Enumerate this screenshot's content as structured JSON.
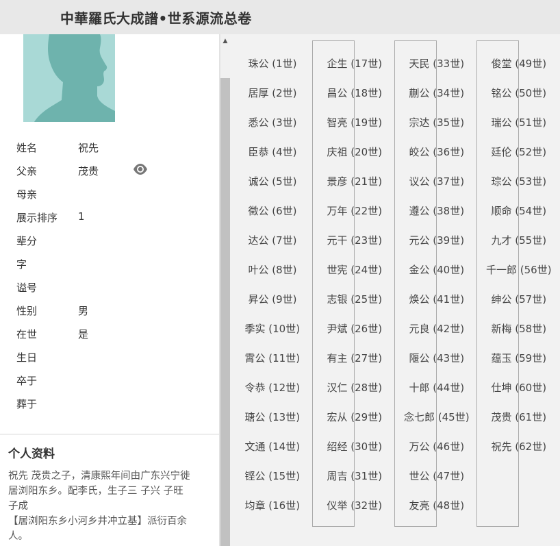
{
  "header": {
    "title": "中華羅氏大成譜•世系源流总卷"
  },
  "profile": {
    "fields": [
      {
        "label": "姓名",
        "value": "祝先"
      },
      {
        "label": "父亲",
        "value": "茂贵"
      },
      {
        "label": "母亲",
        "value": ""
      },
      {
        "label": "展示排序",
        "value": "1"
      },
      {
        "label": "辈分",
        "value": ""
      },
      {
        "label": "字",
        "value": ""
      },
      {
        "label": "谥号",
        "value": ""
      },
      {
        "label": "性别",
        "value": "男"
      },
      {
        "label": "在世",
        "value": "是"
      },
      {
        "label": "生日",
        "value": ""
      },
      {
        "label": "卒于",
        "value": ""
      },
      {
        "label": "葬于",
        "value": ""
      }
    ],
    "section_title": "个人资料",
    "bio_lines": [
      "祝先  茂贵之子，清康熙年间由广东兴宁徙",
      "居浏阳东乡。配李氏，生子三  子兴   子旺",
      "子成",
      "【居浏阳东乡小河乡井冲立基】派衍百余",
      "人。"
    ]
  },
  "scrollbar": {
    "up_arrow": "▲"
  },
  "lineage": {
    "columns": [
      [
        "珠公 (1世)",
        "居厚 (2世)",
        "悉公 (3世)",
        "臣恭 (4世)",
        "诚公 (5世)",
        "徵公 (6世)",
        "达公 (7世)",
        "叶公 (8世)",
        "昇公 (9世)",
        "季实 (10世)",
        "霄公 (11世)",
        "令恭 (12世)",
        "瑭公 (13世)",
        "文通 (14世)",
        "铿公 (15世)",
        "均章 (16世)"
      ],
      [
        "企生 (17世)",
        "昌公 (18世)",
        "智亮 (19世)",
        "庆祖 (20世)",
        "景彦 (21世)",
        "万年 (22世)",
        "元干 (23世)",
        "世宪 (24世)",
        "志银 (25世)",
        "尹斌 (26世)",
        "有主 (27世)",
        "汉仁 (28世)",
        "宏从 (29世)",
        "绍经 (30世)",
        "周吉 (31世)",
        "仪举 (32世)"
      ],
      [
        "天民 (33世)",
        "蒯公 (34世)",
        "宗达 (35世)",
        "皎公 (36世)",
        "议公 (37世)",
        "遵公 (38世)",
        "元公 (39世)",
        "金公 (40世)",
        "焕公 (41世)",
        "元良 (42世)",
        "隁公 (43世)",
        "十郎 (44世)",
        "念七郎 (45世)",
        "万公 (46世)",
        "世公 (47世)",
        "友亮 (48世)"
      ],
      [
        "俊堂 (49世)",
        "铭公 (50世)",
        "瑞公 (51世)",
        "廷伦 (52世)",
        "琮公 (53世)",
        "顺命 (54世)",
        "九才 (55世)",
        "千一郎 (56世)",
        "绅公 (57世)",
        "新梅 (58世)",
        "蕴玉 (59世)",
        "仕坤 (60世)",
        "茂贵 (61世)",
        "祝先 (62世)"
      ]
    ]
  }
}
